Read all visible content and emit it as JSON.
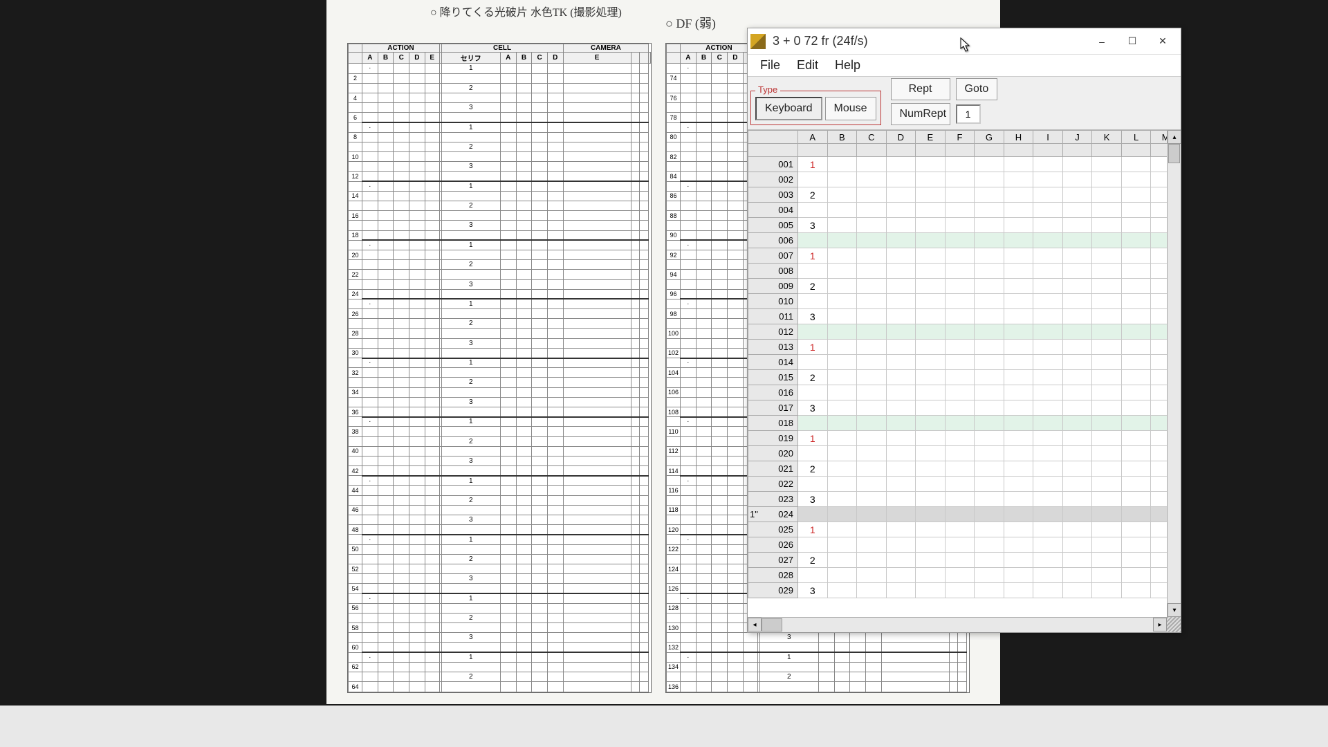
{
  "bg": {
    "note1": "○ 降りてくる光破片 水色TK (撮影処理)",
    "note2": "○ DF (弱)",
    "header_action": "ACTION",
    "header_cell": "CELL",
    "header_camera": "CAMERA",
    "cols": [
      "A",
      "B",
      "C",
      "D",
      "E"
    ],
    "cell_cols": [
      "A",
      "B",
      "C",
      "D",
      "E"
    ],
    "tick": "セリフ"
  },
  "app": {
    "title": "3 + 0   72 fr  (24f/s)",
    "menu": {
      "file": "File",
      "edit": "Edit",
      "help": "Help"
    },
    "type_legend": "Type",
    "btn_keyboard": "Keyboard",
    "btn_mouse": "Mouse",
    "btn_rept": "Rept",
    "btn_goto": "Goto",
    "btn_numrept": "NumRept",
    "num_value": "1",
    "win": {
      "min": "–",
      "max": "☐",
      "close": "✕"
    }
  },
  "grid": {
    "columns": [
      "A",
      "B",
      "C",
      "D",
      "E",
      "F",
      "G",
      "H",
      "I",
      "J",
      "K",
      "L",
      "M"
    ],
    "rows": [
      {
        "n": "001",
        "A": "1",
        "red": true
      },
      {
        "n": "002"
      },
      {
        "n": "003",
        "A": "2"
      },
      {
        "n": "004"
      },
      {
        "n": "005",
        "A": "3"
      },
      {
        "n": "006",
        "six": true
      },
      {
        "n": "007",
        "A": "1",
        "red": true
      },
      {
        "n": "008"
      },
      {
        "n": "009",
        "A": "2"
      },
      {
        "n": "010"
      },
      {
        "n": "011",
        "A": "3"
      },
      {
        "n": "012",
        "six": true
      },
      {
        "n": "013",
        "A": "1",
        "red": true
      },
      {
        "n": "014"
      },
      {
        "n": "015",
        "A": "2"
      },
      {
        "n": "016"
      },
      {
        "n": "017",
        "A": "3"
      },
      {
        "n": "018",
        "six": true
      },
      {
        "n": "019",
        "A": "1",
        "red": true
      },
      {
        "n": "020"
      },
      {
        "n": "021",
        "A": "2"
      },
      {
        "n": "022"
      },
      {
        "n": "023",
        "A": "3"
      },
      {
        "n": "024",
        "six": true,
        "sel": true,
        "mark": "1\""
      },
      {
        "n": "025",
        "A": "1",
        "red": true
      },
      {
        "n": "026"
      },
      {
        "n": "027",
        "A": "2"
      },
      {
        "n": "028"
      },
      {
        "n": "029",
        "A": "3"
      }
    ]
  }
}
